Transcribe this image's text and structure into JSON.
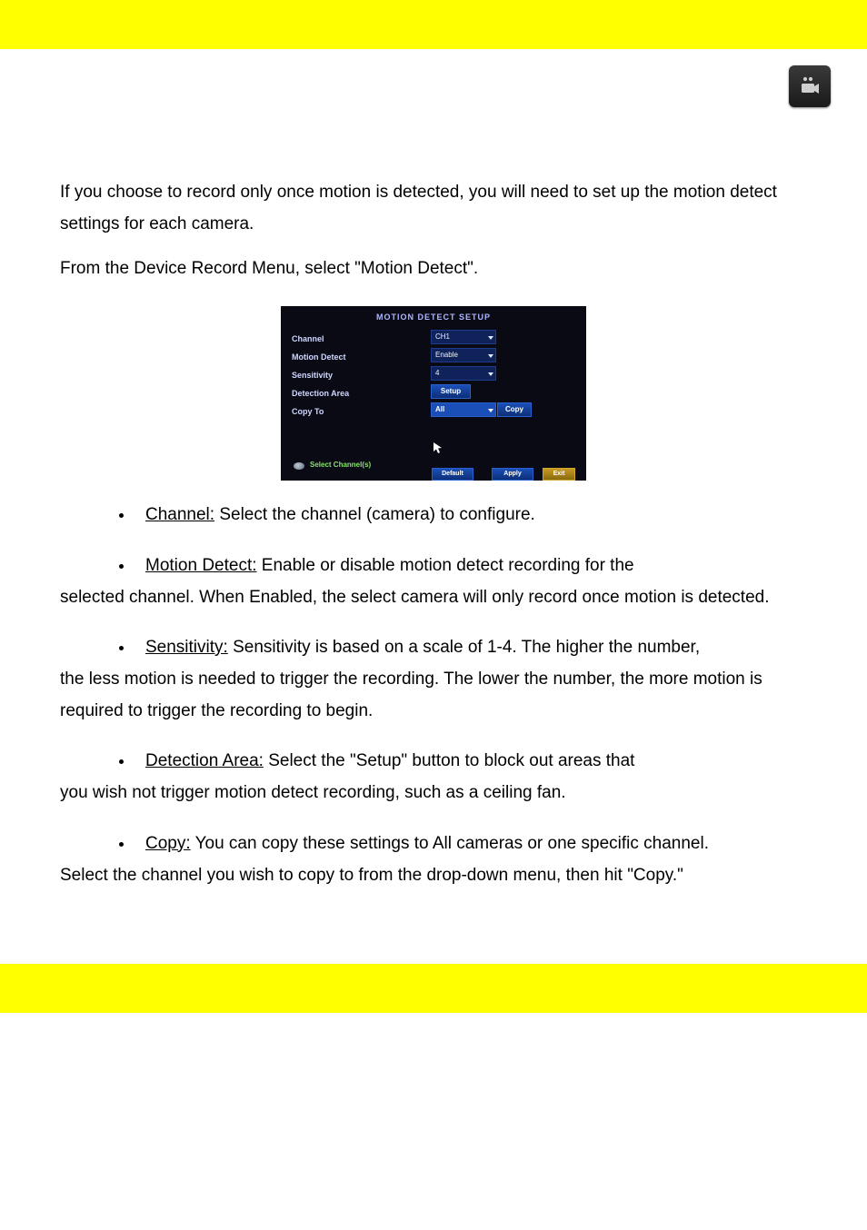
{
  "header": {
    "camera_icon_name": "camera-icon"
  },
  "intro": {
    "p1": "If you choose to record only once motion is detected, you will need to set up the motion detect settings for each camera.",
    "p2": "From the Device Record Menu, select \"Motion Detect\"."
  },
  "screenshot": {
    "title": "MOTION  DETECT  SETUP",
    "rows": {
      "channel": "Channel",
      "motion_detect": "Motion Detect",
      "sensitivity": "Sensitivity",
      "detection_area": "Detection Area",
      "copy_to": "Copy  To"
    },
    "values": {
      "channel": "CH1",
      "motion_detect": "Enable",
      "sensitivity": "4",
      "setup_btn": "Setup",
      "copy_field": "All",
      "copy_btn": "Copy"
    },
    "footer": {
      "select_channels": "Select  Channel(s)",
      "default_btn": "Default",
      "apply_btn": "Apply",
      "exit_btn": "Exit"
    }
  },
  "bullets": {
    "channel_label": "Channel:",
    "channel_text": " Select the channel (camera) to configure.",
    "motion_label1": "Motion",
    "motion_space": " ",
    "motion_label2": "Detect:",
    "motion_text_1": " Enable or disable motion detect recording for the",
    "motion_text_2": "selected channel. When Enabled, the select camera will only record once motion is detected.",
    "sens_label": "Sensitivity:",
    "sens_text_1": " Sensitivity is based on a scale of 1-4. The higher the number,",
    "sens_text_2": "the less motion is needed to trigger the recording. The lower the number, the more motion is required to trigger the recording to begin.",
    "area_label1": "Detection",
    "area_space": " ",
    "area_label2": "Area:",
    "area_text_1": " Select the \"Setup\" button to block out areas that",
    "area_text_2": "you wish not trigger motion detect recording, such as a ceiling fan.",
    "copy_label": "Copy:",
    "copy_text_1": " You can copy these settings to All cameras or one specific channel.",
    "copy_text_2": "Select the channel you wish to copy to from the drop-down menu, then hit \"Copy.\""
  }
}
